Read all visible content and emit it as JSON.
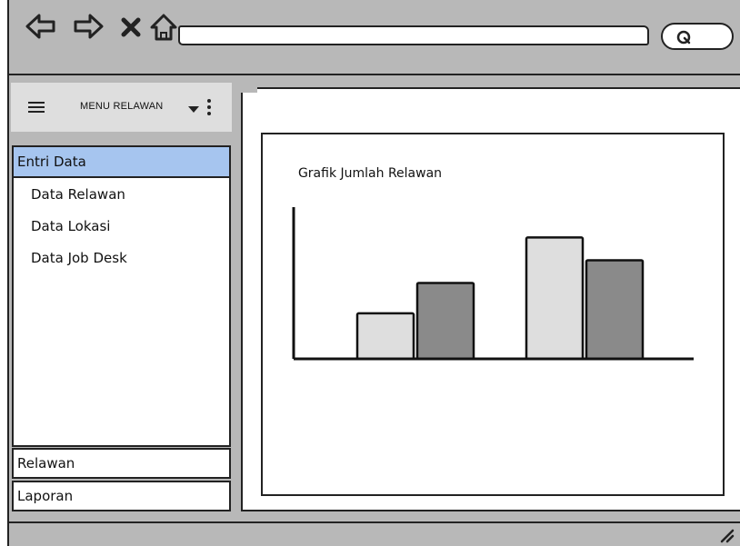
{
  "menu": {
    "title": "MENU RELAWAN"
  },
  "sidebar": {
    "active_section": "Entri Data",
    "sub_items": [
      "Data Relawan",
      "Data Lokasi",
      "Data Job Desk"
    ],
    "sections": [
      "Relawan",
      "Laporan"
    ]
  },
  "icons": {
    "back": "back-arrow-icon",
    "forward": "forward-arrow-icon",
    "stop": "close-icon",
    "home": "home-icon",
    "search": "search-icon",
    "menu": "hamburger-icon",
    "dropdown": "caret-down-icon",
    "more": "kebab-icon"
  },
  "colors": {
    "active_section": "#a6c5ef",
    "frame": "#b8b8b8",
    "bar_light": "#dedede",
    "bar_dark": "#8a8a8a"
  },
  "chart_data": {
    "type": "bar",
    "title": "Grafik Jumlah Relawan",
    "categories": [
      "",
      ""
    ],
    "series": [
      {
        "values": [
          3,
          8
        ]
      },
      {
        "values": [
          5,
          6.5
        ]
      }
    ],
    "ylim": [
      0,
      10
    ],
    "grid": false,
    "legend": "none"
  }
}
